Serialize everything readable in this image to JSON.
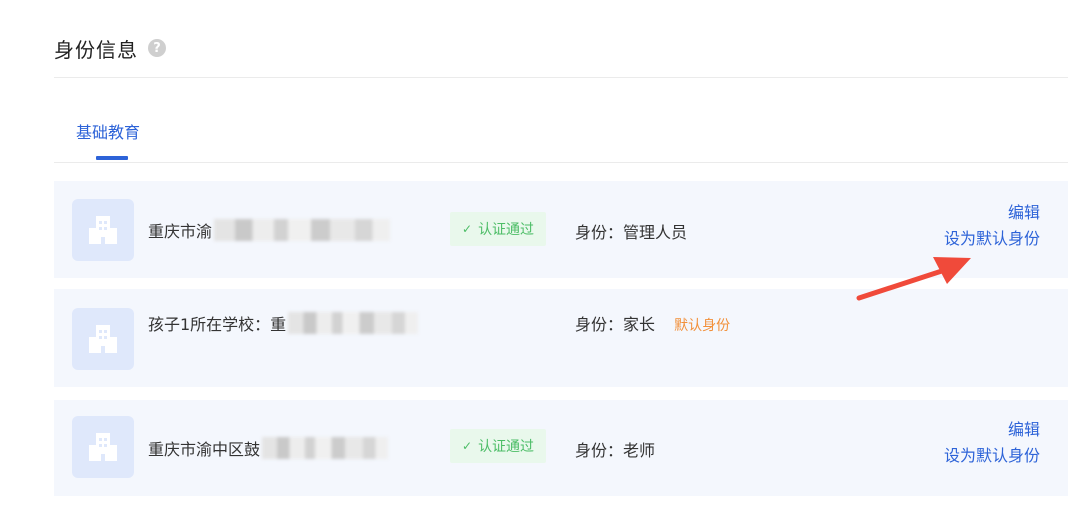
{
  "header": {
    "title": "身份信息",
    "help_icon": "?"
  },
  "tabs": [
    {
      "label": "基础教育",
      "active": true
    }
  ],
  "colors": {
    "accent": "#2d63d8",
    "verified": "#4cbd66",
    "default_tag": "#f2903a",
    "row_bg": "#f4f7fd",
    "arrow": "#f04a3a"
  },
  "rows": [
    {
      "school": "重庆市渝",
      "verified": "认证通过",
      "identity": "身份：管理人员",
      "actions": {
        "edit": "编辑",
        "set_default": "设为默认身份"
      }
    },
    {
      "school": "孩子1所在学校：重",
      "identity": "身份：家长",
      "default_tag": "默认身份"
    },
    {
      "school": "重庆市渝中区鼓",
      "verified": "认证通过",
      "identity": "身份：老师",
      "actions": {
        "edit": "编辑",
        "set_default": "设为默认身份"
      }
    }
  ]
}
